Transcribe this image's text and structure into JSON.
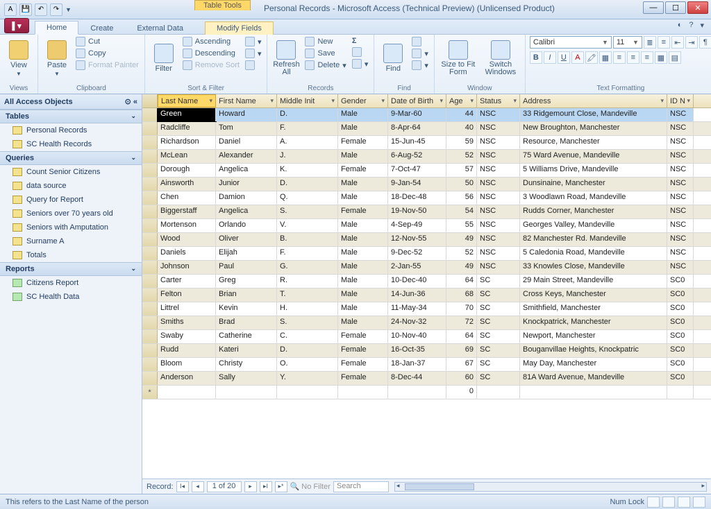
{
  "titlebar": {
    "context_tab_group": "Table Tools",
    "title": "Personal Records - Microsoft Access (Technical Preview) (Unlicensed Product)"
  },
  "tabs": {
    "home": "Home",
    "create": "Create",
    "external": "External Data",
    "modify": "Modify Fields"
  },
  "ribbon": {
    "views": {
      "view": "View",
      "label": "Views"
    },
    "clipboard": {
      "paste": "Paste",
      "cut": "Cut",
      "copy": "Copy",
      "format_painter": "Format Painter",
      "label": "Clipboard"
    },
    "sort": {
      "filter": "Filter",
      "asc": "Ascending",
      "desc": "Descending",
      "remove": "Remove Sort",
      "sel": "",
      "adv": "",
      "tgl": "",
      "label": "Sort & Filter"
    },
    "records": {
      "refresh": "Refresh All",
      "new": "New",
      "save": "Save",
      "delete": "Delete",
      "totals": "",
      "spelling": "",
      "more": "",
      "label": "Records"
    },
    "find": {
      "find": "Find",
      "replace": "",
      "goto": "",
      "select": "",
      "label": "Find"
    },
    "window": {
      "size": "Size to Fit Form",
      "switch": "Switch Windows",
      "label": "Window"
    },
    "text": {
      "font": "Calibri",
      "size": "11",
      "label": "Text Formatting"
    }
  },
  "nav": {
    "header": "All Access Objects",
    "groups": {
      "tables": {
        "label": "Tables",
        "items": [
          "Personal Records",
          "SC Health Records"
        ]
      },
      "queries": {
        "label": "Queries",
        "items": [
          "Count Senior Citizens",
          "data source",
          "Query for Report",
          "Seniors over 70 years old",
          "Seniors with Amputation",
          "Surname A",
          "Totals"
        ]
      },
      "reports": {
        "label": "Reports",
        "items": [
          "Citizens Report",
          "SC Health Data"
        ]
      }
    }
  },
  "columns": [
    "Last Name",
    "First Name",
    "Middle Init",
    "Gender",
    "Date of Birth",
    "Age",
    "Status",
    "Address",
    "ID N"
  ],
  "rows": [
    [
      "Green",
      "Howard",
      "D.",
      "Male",
      "9-Mar-60",
      "44",
      "NSC",
      "33 Ridgemount Close, Mandeville",
      "NSC"
    ],
    [
      "Radcliffe",
      "Tom",
      "F.",
      "Male",
      "8-Apr-64",
      "40",
      "NSC",
      "New Broughton, Manchester",
      "NSC"
    ],
    [
      "Richardson",
      "Daniel",
      "A.",
      "Female",
      "15-Jun-45",
      "59",
      "NSC",
      "Resource, Manchester",
      "NSC"
    ],
    [
      "McLean",
      "Alexander",
      "J.",
      "Male",
      "6-Aug-52",
      "52",
      "NSC",
      "75 Ward Avenue, Mandeville",
      "NSC"
    ],
    [
      "Dorough",
      "Angelica",
      "K.",
      "Female",
      "7-Oct-47",
      "57",
      "NSC",
      "5 Williams Drive, Mandeville",
      "NSC"
    ],
    [
      "Ainsworth",
      "Junior",
      "D.",
      "Male",
      "9-Jan-54",
      "50",
      "NSC",
      "Dunsinaine, Manchester",
      "NSC"
    ],
    [
      "Chen",
      "Damion",
      "Q.",
      "Male",
      "18-Dec-48",
      "56",
      "NSC",
      "3 Woodlawn Road, Mandeville",
      "NSC"
    ],
    [
      "Biggerstaff",
      "Angelica",
      "S.",
      "Female",
      "19-Nov-50",
      "54",
      "NSC",
      "Rudds Corner, Manchester",
      "NSC"
    ],
    [
      "Mortenson",
      "Orlando",
      "V.",
      "Male",
      "4-Sep-49",
      "55",
      "NSC",
      "Georges Valley, Mandeville",
      "NSC"
    ],
    [
      "Wood",
      "Oliver",
      "B.",
      "Male",
      "12-Nov-55",
      "49",
      "NSC",
      "82 Manchester Rd. Mandeville",
      "NSC"
    ],
    [
      "Daniels",
      "Elijah",
      "F.",
      "Male",
      "9-Dec-52",
      "52",
      "NSC",
      "5 Caledonia Road, Mandeville",
      "NSC"
    ],
    [
      "Johnson",
      "Paul",
      "G.",
      "Male",
      "2-Jan-55",
      "49",
      "NSC",
      "33 Knowles Close, Mandeville",
      "NSC"
    ],
    [
      "Carter",
      "Greg",
      "R.",
      "Male",
      "10-Dec-40",
      "64",
      "SC",
      "29 Main Street, Mandeville",
      "SC0"
    ],
    [
      "Felton",
      "Brian",
      "T.",
      "Male",
      "14-Jun-36",
      "68",
      "SC",
      "Cross Keys, Manchester",
      "SC0"
    ],
    [
      "Littrel",
      "Kevin",
      "H.",
      "Male",
      "11-May-34",
      "70",
      "SC",
      "Smithfield, Manchester",
      "SC0"
    ],
    [
      "Smiths",
      "Brad",
      "S.",
      "Male",
      "24-Nov-32",
      "72",
      "SC",
      "Knockpatrick, Manchester",
      "SC0"
    ],
    [
      "Swaby",
      "Catherine",
      "C.",
      "Female",
      "10-Nov-40",
      "64",
      "SC",
      "Newport, Manchester",
      "SC0"
    ],
    [
      "Rudd",
      "Kateri",
      "D.",
      "Female",
      "16-Oct-35",
      "69",
      "SC",
      "Bouganvillae Heights, Knockpatric",
      "SC0"
    ],
    [
      "Bloom",
      "Christy",
      "O.",
      "Female",
      "18-Jan-37",
      "67",
      "SC",
      "May Day, Manchester",
      "SC0"
    ],
    [
      "Anderson",
      "Sally",
      "Y.",
      "Female",
      "8-Dec-44",
      "60",
      "SC",
      "81A Ward Avenue, Mandeville",
      "SC0"
    ]
  ],
  "new_row_age": "0",
  "record_nav": {
    "label": "Record:",
    "pos": "1 of 20",
    "nofilter": "No Filter",
    "search": "Search"
  },
  "status": {
    "left": "This refers to the Last Name of the person",
    "numlock": "Num Lock"
  }
}
